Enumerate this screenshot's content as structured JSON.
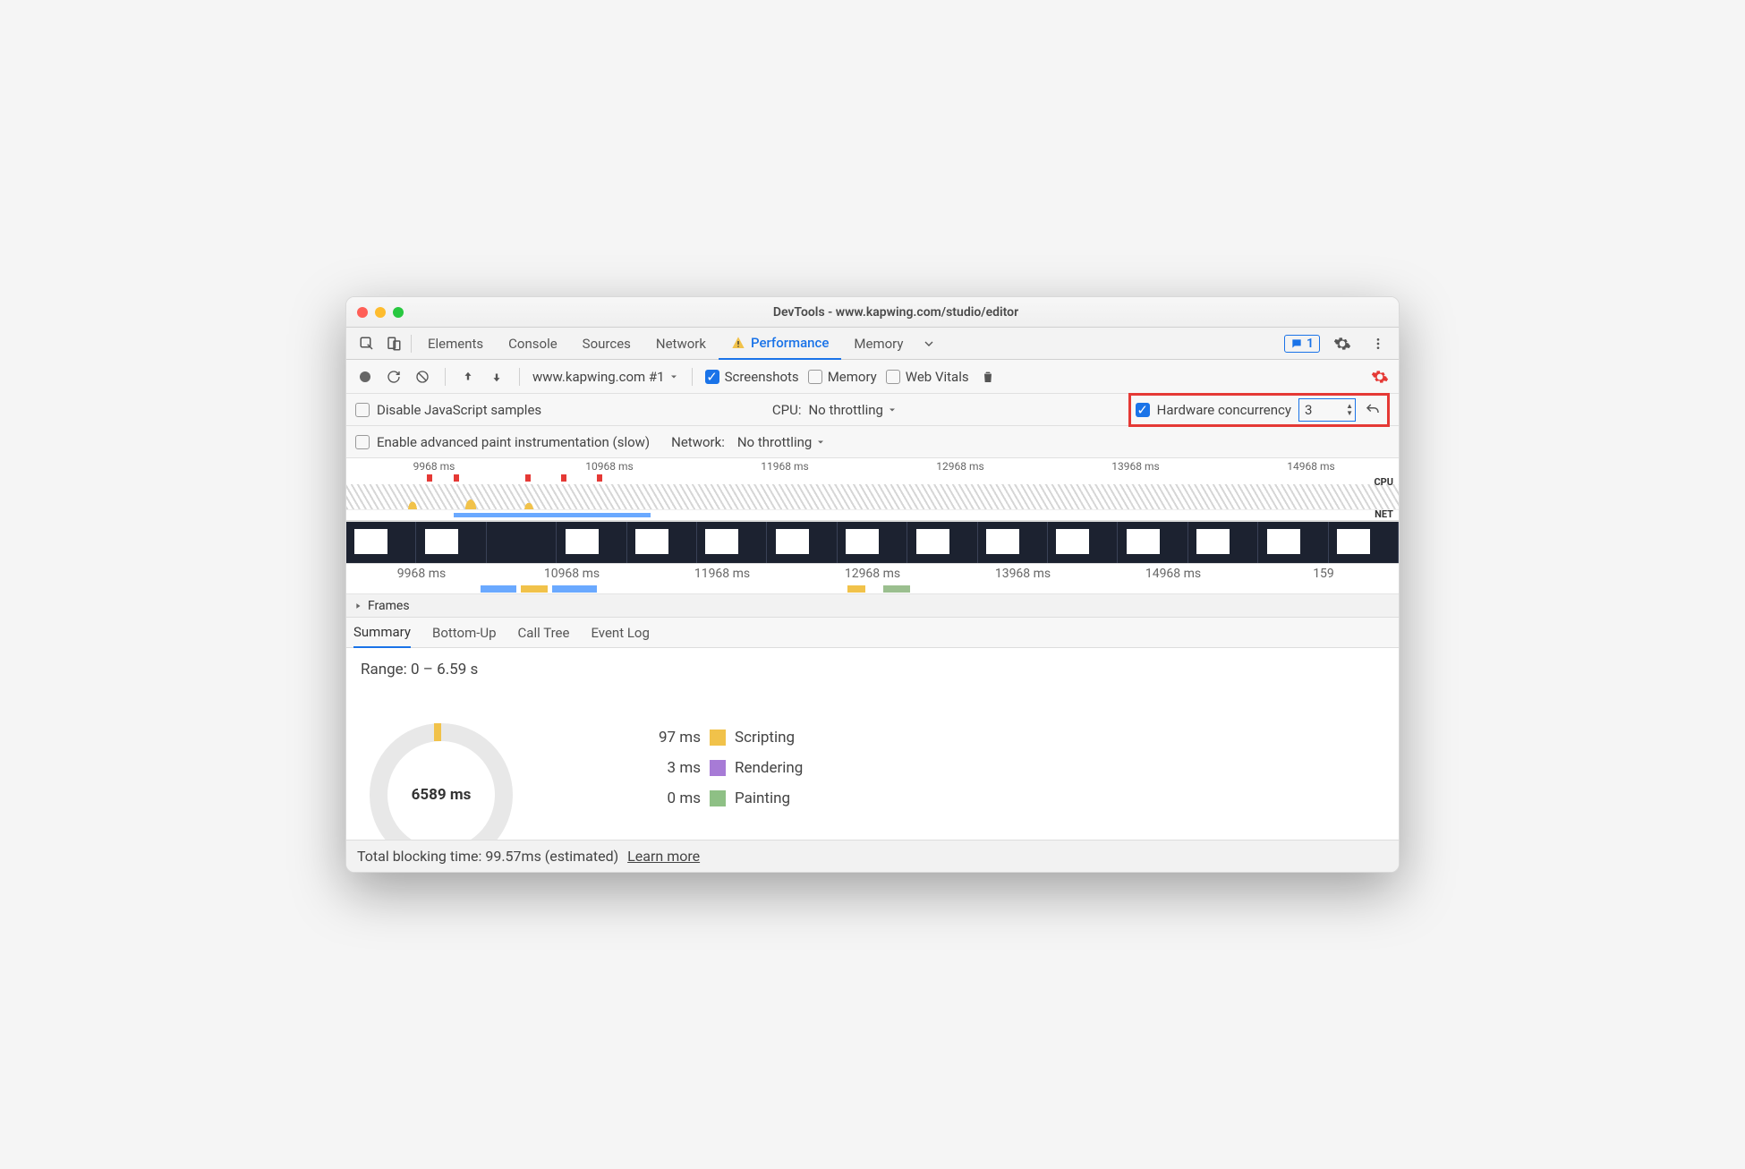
{
  "window": {
    "title": "DevTools - www.kapwing.com/studio/editor"
  },
  "tabs": {
    "items": [
      "Elements",
      "Console",
      "Sources",
      "Network",
      "Performance",
      "Memory"
    ],
    "active": "Performance",
    "issues_count": "1"
  },
  "toolbar": {
    "target_label": "www.kapwing.com #1",
    "screenshots_label": "Screenshots",
    "memory_label": "Memory",
    "webvitals_label": "Web Vitals"
  },
  "options": {
    "disable_js_label": "Disable JavaScript samples",
    "cpu_label": "CPU:",
    "cpu_value": "No throttling",
    "hw_label": "Hardware concurrency",
    "hw_value": "3",
    "paint_label": "Enable advanced paint instrumentation (slow)",
    "net_label": "Network:",
    "net_value": "No throttling"
  },
  "timeline": {
    "markers": [
      "9968 ms",
      "10968 ms",
      "11968 ms",
      "12968 ms",
      "13968 ms",
      "14968 ms"
    ],
    "markers2": [
      "9968 ms",
      "10968 ms",
      "11968 ms",
      "12968 ms",
      "13968 ms",
      "14968 ms",
      "159"
    ],
    "cpu_label": "CPU",
    "net_label": "NET"
  },
  "sections": {
    "frames": "Frames"
  },
  "subtabs": {
    "items": [
      "Summary",
      "Bottom-Up",
      "Call Tree",
      "Event Log"
    ],
    "active": "Summary"
  },
  "summary": {
    "range": "Range: 0 – 6.59 s",
    "center": "6589 ms",
    "legend": [
      {
        "value": "97 ms",
        "color": "#f1c24a",
        "label": "Scripting"
      },
      {
        "value": "3 ms",
        "color": "#a77bd6",
        "label": "Rendering"
      },
      {
        "value": "0 ms",
        "color": "#8ec085",
        "label": "Painting"
      }
    ]
  },
  "footer": {
    "text": "Total blocking time: 99.57ms (estimated)",
    "link": "Learn more"
  },
  "chart_data": {
    "type": "pie",
    "title": "",
    "series": [
      {
        "name": "Scripting",
        "value": 97,
        "unit": "ms",
        "color": "#f1c24a"
      },
      {
        "name": "Rendering",
        "value": 3,
        "unit": "ms",
        "color": "#a77bd6"
      },
      {
        "name": "Painting",
        "value": 0,
        "unit": "ms",
        "color": "#8ec085"
      }
    ],
    "total_ms": 6589,
    "range_seconds": [
      0,
      6.59
    ]
  }
}
